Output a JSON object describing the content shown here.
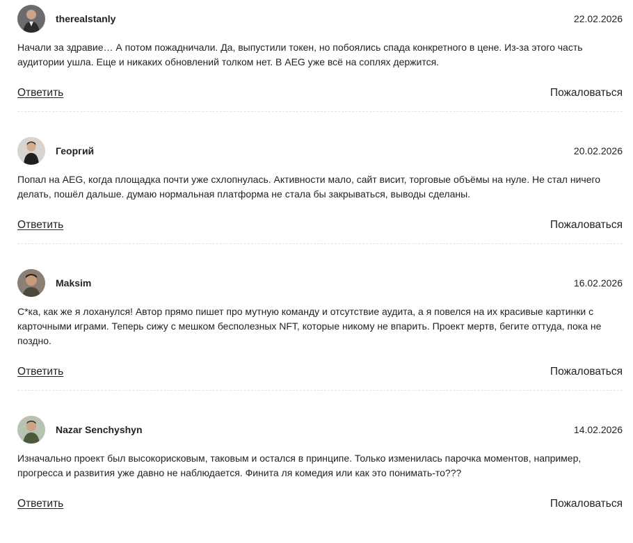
{
  "comments": [
    {
      "author": "therealstanly",
      "date": "22.02.2026",
      "text": "Начали за здравие… А потом пожадничали. Да, выпустили токен, но побоялись спада конкретного в цене. Из-за этого часть аудитории ушла. Еще и никаких обновлений толком нет. В AEG уже всё на соплях держится.",
      "reply_label": "Ответить",
      "report_label": "Пожаловаться"
    },
    {
      "author": "Георгий",
      "date": "20.02.2026",
      "text": "Попал на AEG, когда площадка почти уже схлопнулась. Активности мало, сайт висит, торговые объёмы на нуле. Не стал ничего делать, пошёл дальше. думаю нормальная платформа не стала бы закрываться, выводы сделаны.",
      "reply_label": "Ответить",
      "report_label": "Пожаловаться"
    },
    {
      "author": "Maksim",
      "date": "16.02.2026",
      "text": "С*ка, как же я лоханулся! Автор прямо пишет про мутную команду и отсутствие аудита, а я повелся на их красивые картинки с карточными играми. Теперь сижу с мешком бесполезных NFT, которые никому не впарить. Проект мертв, бегите оттуда, пока не поздно.",
      "reply_label": "Ответить",
      "report_label": "Пожаловаться"
    },
    {
      "author": "Nazar Senchyshyn",
      "date": "14.02.2026",
      "text": "Изначально проект был высокорисковым, таковым и остался в принципе. Только изменилась парочка моментов, например, прогресса и развития уже давно не наблюдается. Финита ля комедия или как это понимать-то???",
      "reply_label": "Ответить",
      "report_label": "Пожаловаться"
    }
  ]
}
